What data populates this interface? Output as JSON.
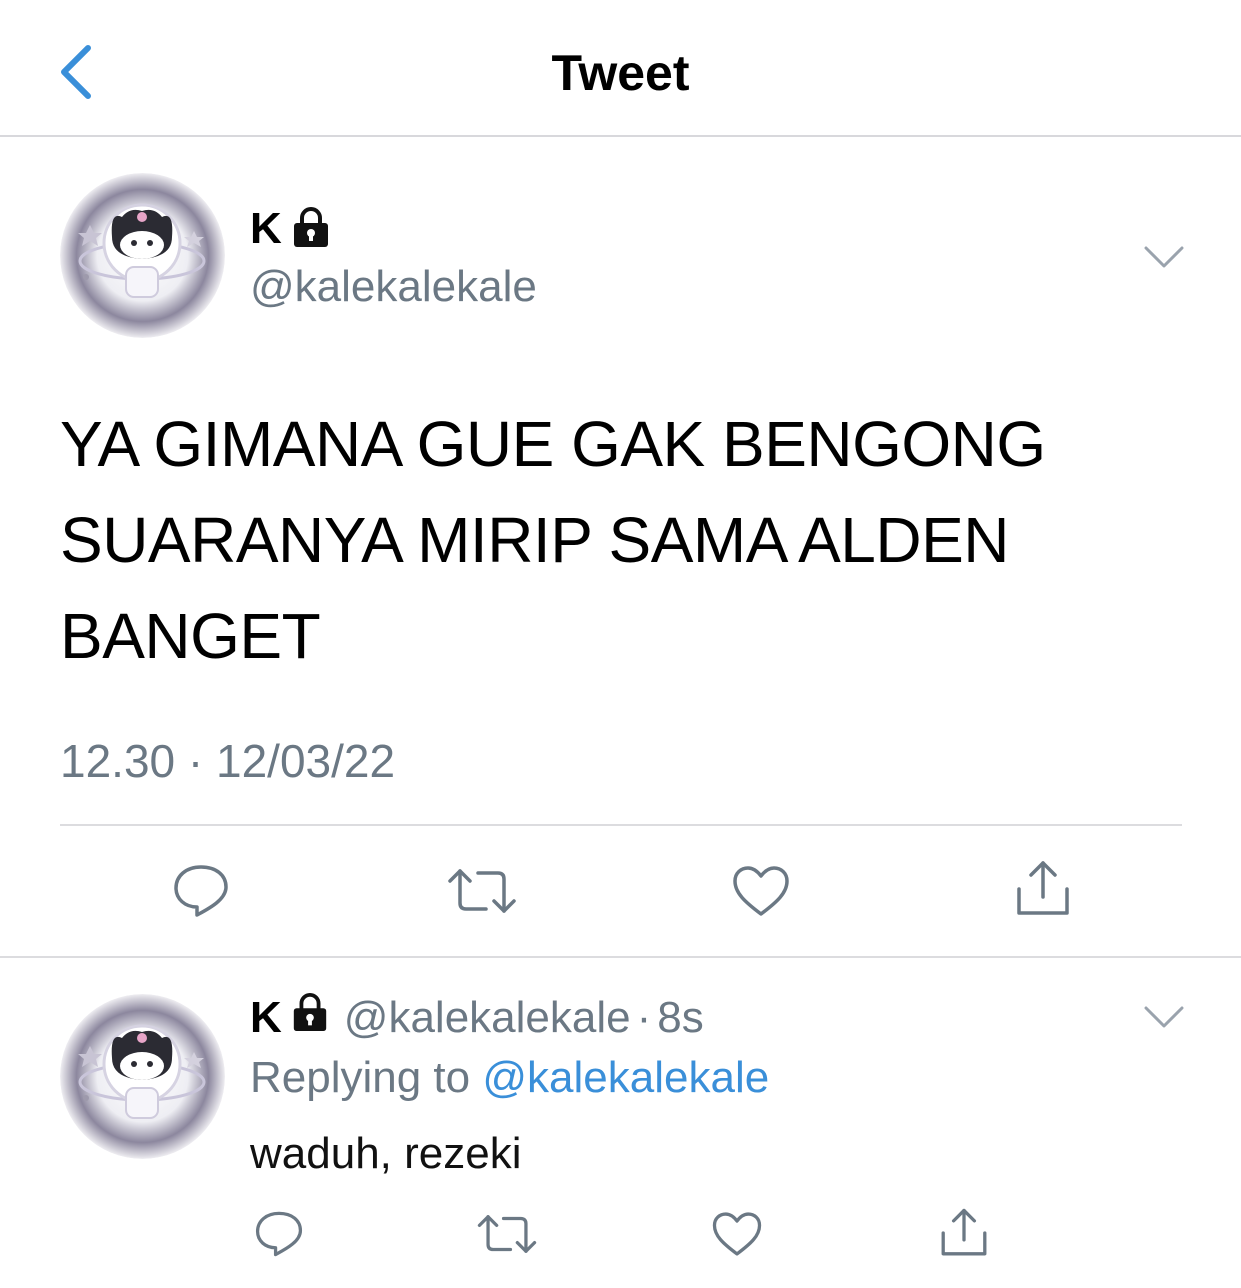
{
  "header": {
    "title": "Tweet",
    "back_icon": "chevron-left-icon"
  },
  "colors": {
    "accent": "#3a8fd9",
    "secondary_text": "#6b7884",
    "divider": "#dcdcdf"
  },
  "tweet": {
    "display_name": "K",
    "handle": "@kalekalekale",
    "text": "YA GIMANA GUE GAK BENGONG SUARANYA MIRIP SAMA ALDEN BANGET",
    "time": "12.30",
    "separator": "·",
    "date": "12/03/22",
    "actions": [
      "reply-icon",
      "retweet-icon",
      "like-icon",
      "share-icon"
    ]
  },
  "reply": {
    "display_name": "K",
    "handle": "@kalekalekale",
    "separator": "·",
    "time": "8s",
    "replying_prefix": "Replying to",
    "replying_handle": "@kalekalekale",
    "text": "waduh, rezeki",
    "actions": [
      "reply-icon",
      "retweet-icon",
      "like-icon",
      "share-icon"
    ]
  }
}
